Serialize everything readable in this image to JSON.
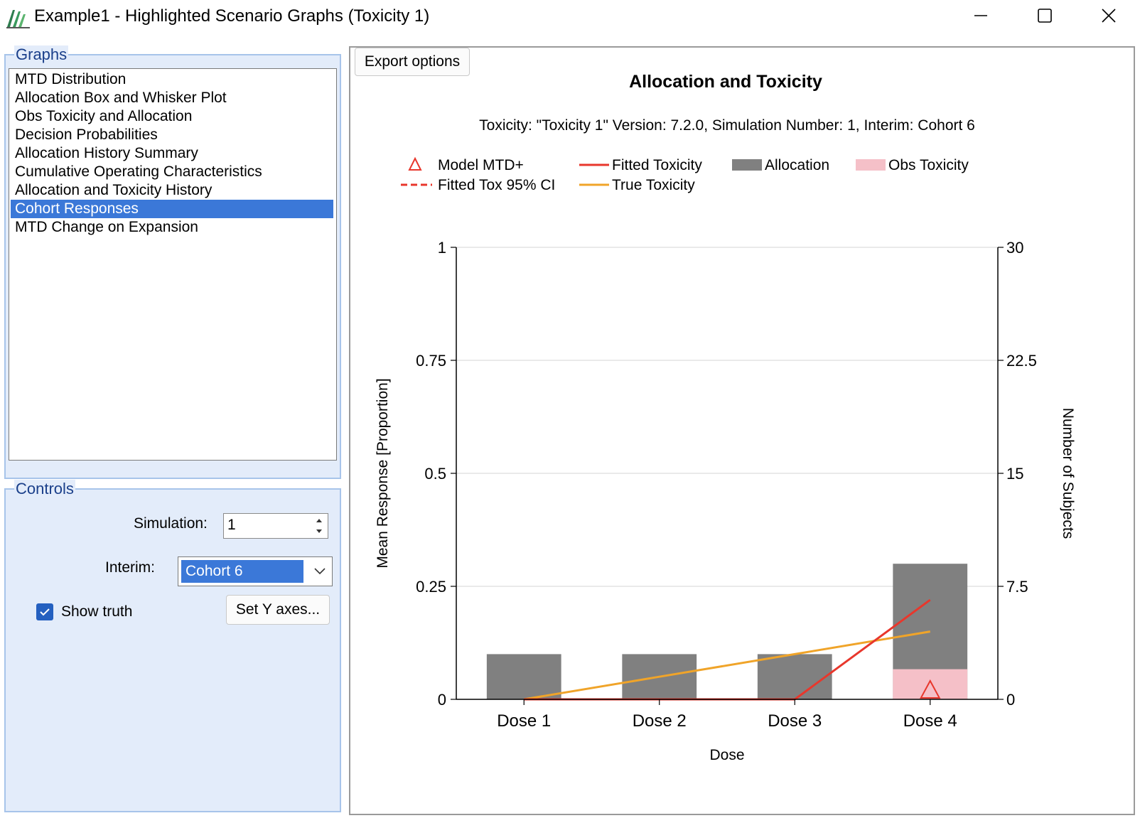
{
  "window": {
    "title": "Example1 - Highlighted Scenario Graphs (Toxicity 1)"
  },
  "graphs": {
    "label": "Graphs",
    "items": [
      "MTD Distribution",
      "Allocation Box and Whisker Plot",
      "Obs Toxicity and Allocation",
      "Decision Probabilities",
      "Allocation History Summary",
      "Cumulative Operating Characteristics",
      "Allocation and Toxicity History",
      "Cohort Responses",
      "MTD Change on Expansion"
    ],
    "selected_index": 7
  },
  "controls": {
    "label": "Controls",
    "simulation_label": "Simulation:",
    "simulation_value": "1",
    "interim_label": "Interim:",
    "interim_value": "Cohort 6",
    "show_truth_label": "Show truth",
    "show_truth_checked": true,
    "set_y_axes_label": "Set Y axes..."
  },
  "toolbar": {
    "export_label": "Export options"
  },
  "chart_data": {
    "type": "bar",
    "title": "Allocation and Toxicity",
    "subtitle": "Toxicity: \"Toxicity 1\" Version: 7.2.0, Simulation Number: 1, Interim: Cohort 6",
    "categories": [
      "Dose 1",
      "Dose 2",
      "Dose 3",
      "Dose 4"
    ],
    "xlabel": "Dose",
    "ylabel": "Mean Response [Proportion]",
    "y2label": "Number of Subjects",
    "ylim": [
      0,
      1
    ],
    "y2lim": [
      0,
      30
    ],
    "yticks": [
      "0",
      "0.25",
      "0.5",
      "0.75",
      "1"
    ],
    "y2ticks": [
      "0",
      "7.5",
      "15",
      "22.5",
      "30"
    ],
    "grid": true,
    "legend": {
      "placement": "top",
      "entries": [
        {
          "label": "Model MTD+",
          "marker": "triangle",
          "color": "#e8372c"
        },
        {
          "label": "Fitted Toxicity",
          "marker": "line",
          "color": "#e8372c"
        },
        {
          "label": "Allocation",
          "marker": "box",
          "color": "#808080"
        },
        {
          "label": "Obs Toxicity",
          "marker": "box",
          "color": "#f5c0c8"
        },
        {
          "label": "Fitted Tox 95% CI",
          "marker": "dashed",
          "color": "#e8372c"
        },
        {
          "label": "True Toxicity",
          "marker": "line",
          "color": "#f0a429"
        }
      ]
    },
    "series": [
      {
        "name": "Allocation",
        "axis": "y2",
        "values": [
          3,
          3,
          3,
          9
        ],
        "color": "#808080"
      },
      {
        "name": "Obs Toxicity",
        "axis": "y2",
        "values": [
          0,
          0,
          0,
          2
        ],
        "color": "#f5c0c8"
      },
      {
        "name": "Fitted Toxicity",
        "axis": "y",
        "values": [
          0,
          0,
          0,
          0.22
        ],
        "color": "#e8372c"
      },
      {
        "name": "True Toxicity",
        "axis": "y",
        "values": [
          0,
          0.05,
          0.1,
          0.15
        ],
        "color": "#f0a429"
      },
      {
        "name": "Model MTD+",
        "axis": "y",
        "values": [
          null,
          null,
          null,
          0
        ],
        "color": "#e8372c"
      }
    ]
  }
}
